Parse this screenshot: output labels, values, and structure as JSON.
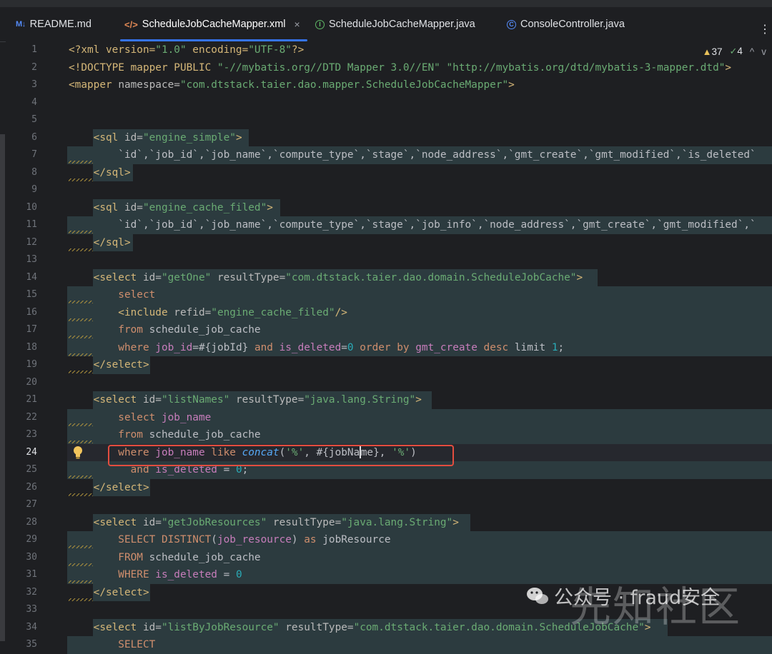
{
  "tabs": [
    {
      "label": "README.md",
      "icon": "markdown-icon",
      "icon_text": "M↓"
    },
    {
      "label": "ScheduleJobCacheMapper.xml",
      "icon": "xml-icon",
      "icon_text": "</>",
      "close": "×"
    },
    {
      "label": "ScheduleJobCacheMapper.java",
      "icon": "interface-icon",
      "icon_text": "I"
    },
    {
      "label": "ConsoleController.java",
      "icon": "class-icon",
      "icon_text": "C"
    }
  ],
  "more_menu": "⋮",
  "inspections": {
    "warnings": "37",
    "typos": "4",
    "up": "^",
    "down": "v",
    "warn_symbol": "▲",
    "check_symbol": "✓"
  },
  "line_numbers": [
    "1",
    "2",
    "3",
    "4",
    "5",
    "6",
    "7",
    "8",
    "9",
    "10",
    "11",
    "12",
    "13",
    "14",
    "15",
    "16",
    "17",
    "18",
    "19",
    "20",
    "21",
    "22",
    "23",
    "24",
    "25",
    "26",
    "27",
    "28",
    "29",
    "30",
    "31",
    "32",
    "33",
    "34",
    "35"
  ],
  "current_line": "24",
  "code_text": {
    "l1a": "<?xml version=",
    "l1b": "\"1.0\"",
    "l1c": " encoding=",
    "l1d": "\"UTF-8\"",
    "l1e": "?>",
    "l2a": "<!DOCTYPE mapper PUBLIC ",
    "l2b": "\"-//mybatis.org//DTD Mapper 3.0//EN\"",
    "l2c": " ",
    "l2d": "\"http://mybatis.org/dtd/mybatis-3-mapper.dtd\"",
    "l2e": ">",
    "l3a": "<mapper",
    "l3b": " namespace=",
    "l3c": "\"com.dtstack.taier.dao.mapper.ScheduleJobCacheMapper\"",
    "l3d": ">",
    "l6a": "    <sql",
    "l6b": " id=",
    "l6c": "\"engine_simple\"",
    "l6d": ">",
    "l7": "        `id`,`job_id`,`job_name`,`compute_type`,`stage`,`node_address`,`gmt_create`,`gmt_modified`,`is_deleted`",
    "l8": "    </sql>",
    "l10a": "    <sql",
    "l10b": " id=",
    "l10c": "\"engine_cache_filed\"",
    "l10d": ">",
    "l11": "        `id`,`job_id`,`job_name`,`compute_type`,`stage`,`job_info`,`node_address`,`gmt_create`,`gmt_modified`,`",
    "l12": "    </sql>",
    "l14a": "    <select",
    "l14b": " id=",
    "l14c": "\"getOne\"",
    "l14d": " resultType=",
    "l14e": "\"com.dtstack.taier.dao.domain.ScheduleJobCache\"",
    "l14f": ">",
    "l15": "        select",
    "l16a": "        <include",
    "l16b": " refid=",
    "l16c": "\"engine_cache_filed\"",
    "l16d": "/>",
    "l17a": "        from",
    "l17b": " schedule_job_cache",
    "l18a": "        where",
    "l18b": " job_id",
    "l18c": "=#{jobId} ",
    "l18d": "and",
    "l18e": " is_deleted",
    "l18f": "=",
    "l18g": "0",
    "l18h": " order by ",
    "l18i": "gmt_create",
    "l18j": " desc",
    "l18k": " limit ",
    "l18l": "1",
    "l18m": ";",
    "l19": "    </select>",
    "l22a": "    <select",
    "l22b": " id=",
    "l22c": "\"listNames\"",
    "l22d": " resultType=",
    "l22e": "\"java.lang.String\"",
    "l22f": ">",
    "l23a": "        select",
    "l23b": " job_name",
    "l24a": "        where",
    "l24b": " job_name",
    "l24c": " like ",
    "l24d": "concat",
    "l24e": "(",
    "l24f": "'%'",
    "l24g": ", #{jobNa",
    "l24h": "me}, ",
    "l24i": "'%'",
    "l24j": ")",
    "l25a": "          and",
    "l25b": " is_deleted",
    "l25c": " = ",
    "l25d": "0",
    "l25e": ";",
    "l26": "    </select>",
    "l28a": "    <select",
    "l28b": " id=",
    "l28c": "\"getJobResources\"",
    "l28d": " resultType=",
    "l28e": "\"java.lang.String\"",
    "l28f": ">",
    "l29a": "        SELECT DISTINCT",
    "l29b": "(",
    "l29c": "job_resource",
    "l29d": ") ",
    "l29e": "as",
    "l29f": " jobResource",
    "l30a": "        FROM",
    "l30b": " schedule_job_cache",
    "l31a": "        WHERE",
    "l31b": " is_deleted",
    "l31c": " = ",
    "l31d": "0",
    "l32": "    </select>",
    "l34a": "    <select",
    "l34b": " id=",
    "l34c": "\"listByJobResource\"",
    "l34d": " resultType=",
    "l34e": "\"com.dtstack.taier.dao.domain.ScheduleJobCache\"",
    "l34f": ">",
    "l35": "        SELECT"
  },
  "watermark": {
    "small": "公众号 · fraud安全",
    "big": "先知社区"
  },
  "colors": {
    "background": "#1e1f22",
    "tag": "#d5b778",
    "string": "#6aab73",
    "keyword": "#cf8e6d",
    "highlight_box": "#e34d3f",
    "tab_underline": "#3574f0"
  }
}
